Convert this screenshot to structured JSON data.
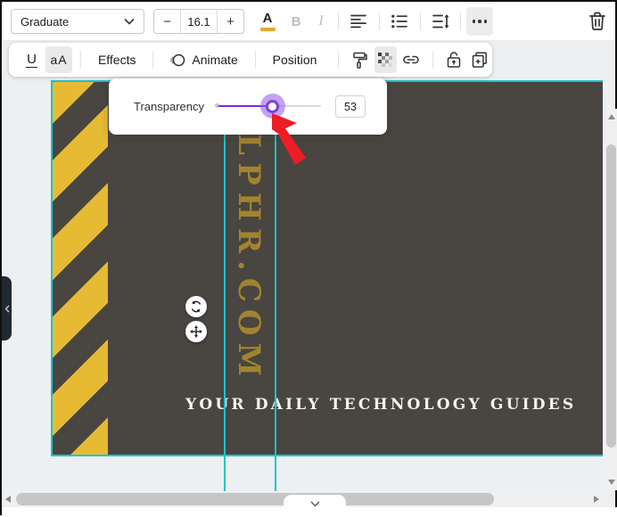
{
  "colors": {
    "accent-purple": "#7d2ae8",
    "cyan": "#18c4cd",
    "canvas-dark": "#494540",
    "stripe-yellow": "#e7ba33",
    "text-gold": "#a1842e",
    "cursor-red": "#ee1c23"
  },
  "toolbar": {
    "font_name": "Graduate",
    "font_size": "16.1",
    "decrease_label": "−",
    "increase_label": "+",
    "text_color_label": "A",
    "bold_label": "B",
    "italic_label": "I"
  },
  "toolbar2": {
    "underline_label": "U",
    "case_label": "aA",
    "effects_label": "Effects",
    "animate_label": "Animate",
    "position_label": "Position"
  },
  "popover": {
    "label": "Transparency",
    "value": "53"
  },
  "canvas": {
    "vertical_text": "ALPHR.COM",
    "tagline": "YOUR DAILY TECHNOLOGY GUIDES"
  }
}
